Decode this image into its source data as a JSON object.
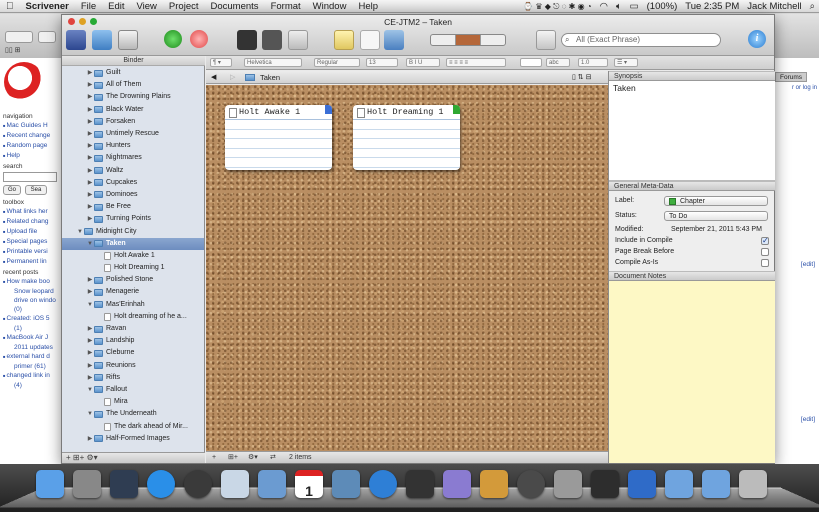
{
  "menubar": {
    "apple": "",
    "app": "Scrivener",
    "items": [
      "File",
      "Edit",
      "View",
      "Project",
      "Documents",
      "Format",
      "Window",
      "Help"
    ],
    "battery": "(100%)",
    "clock": "Tue 2:35 PM",
    "user": "Jack Mitchell"
  },
  "browser": {
    "forums_tab": "Forums",
    "login": "r or log in",
    "sections": {
      "navigation": "navigation",
      "nav_links": [
        "Mac Guides H",
        "Recent change",
        "Random page",
        "Help"
      ],
      "search": "search",
      "go": "Go",
      "sea": "Sea",
      "toolbox": "toolbox",
      "toolbox_links": [
        "What links her",
        "Related chang",
        "Upload file",
        "Special pages",
        "Printable versi",
        "Permanent lin"
      ],
      "recent_posts": "recent posts",
      "posts": [
        "How make boo",
        "Snow leopard",
        "drive on windo",
        "(0)",
        "Created: iOS 5",
        "(1)",
        "MacBook Air J",
        "2011 updates",
        "external hard d",
        "primer (61)",
        "changed link in",
        "(4)"
      ]
    },
    "edit1": "[edit]",
    "edit2": "[edit]"
  },
  "window": {
    "title": "CE-JTM2 – Taken",
    "search_placeholder": "All (Exact Phrase)"
  },
  "format_bar": {
    "font": "Helvetica",
    "style": "Regular",
    "size": "13",
    "abc": "abc",
    "spacing": "1.0"
  },
  "binder": {
    "header": "Binder",
    "items": [
      {
        "label": "Guilt",
        "depth": 1,
        "type": "folder",
        "expanded": false
      },
      {
        "label": "All of Them",
        "depth": 1,
        "type": "folder",
        "expanded": false
      },
      {
        "label": "The Drowning Plains",
        "depth": 1,
        "type": "folder",
        "expanded": false
      },
      {
        "label": "Black Water",
        "depth": 1,
        "type": "folder",
        "expanded": false
      },
      {
        "label": "Forsaken",
        "depth": 1,
        "type": "folder",
        "expanded": false
      },
      {
        "label": "Untimely Rescue",
        "depth": 1,
        "type": "folder",
        "expanded": false
      },
      {
        "label": "Hunters",
        "depth": 1,
        "type": "folder",
        "expanded": false
      },
      {
        "label": "Nightmares",
        "depth": 1,
        "type": "folder",
        "expanded": false
      },
      {
        "label": "Waltz",
        "depth": 1,
        "type": "folder",
        "expanded": false
      },
      {
        "label": "Cupcakes",
        "depth": 1,
        "type": "folder",
        "expanded": false
      },
      {
        "label": "Dominoes",
        "depth": 1,
        "type": "folder",
        "expanded": false
      },
      {
        "label": "Be Free",
        "depth": 1,
        "type": "folder",
        "expanded": false
      },
      {
        "label": "Turning Points",
        "depth": 1,
        "type": "folder",
        "expanded": false
      },
      {
        "label": "Midnight City",
        "depth": 0,
        "type": "folder",
        "expanded": true
      },
      {
        "label": "Taken",
        "depth": 1,
        "type": "folder",
        "expanded": true,
        "selected": true
      },
      {
        "label": "Holt Awake 1",
        "depth": 2,
        "type": "doc"
      },
      {
        "label": "Holt Dreaming 1",
        "depth": 2,
        "type": "doc"
      },
      {
        "label": "Polished Stone",
        "depth": 1,
        "type": "folder",
        "expanded": false
      },
      {
        "label": "Menagerie",
        "depth": 1,
        "type": "folder",
        "expanded": false
      },
      {
        "label": "Mas'Erinhah",
        "depth": 1,
        "type": "folder",
        "expanded": true
      },
      {
        "label": "Holt dreaming of he a...",
        "depth": 2,
        "type": "doc"
      },
      {
        "label": "Ravan",
        "depth": 1,
        "type": "folder",
        "expanded": false
      },
      {
        "label": "Landship",
        "depth": 1,
        "type": "folder",
        "expanded": false
      },
      {
        "label": "Cleburne",
        "depth": 1,
        "type": "folder",
        "expanded": false
      },
      {
        "label": "Reunions",
        "depth": 1,
        "type": "folder",
        "expanded": false
      },
      {
        "label": "Rifts",
        "depth": 1,
        "type": "folder",
        "expanded": false
      },
      {
        "label": "Fallout",
        "depth": 1,
        "type": "folder",
        "expanded": true
      },
      {
        "label": "Mira",
        "depth": 2,
        "type": "doc"
      },
      {
        "label": "The Underneath",
        "depth": 1,
        "type": "folder",
        "expanded": true
      },
      {
        "label": "The dark ahead of Mir...",
        "depth": 2,
        "type": "doc"
      },
      {
        "label": "Half-Formed Images",
        "depth": 1,
        "type": "folder",
        "expanded": false
      }
    ],
    "footer": "+ ⊞+ ⚙▾"
  },
  "editor": {
    "header_title": "Taken",
    "cards": [
      {
        "title": "Holt Awake 1",
        "flag_color": "#3b6fd6"
      },
      {
        "title": "Holt Dreaming 1",
        "flag_color": "#2fa832"
      }
    ],
    "footer_count": "2 items"
  },
  "inspector": {
    "synopsis_header": "Synopsis",
    "synopsis_text": "Taken",
    "meta_header": "General Meta-Data",
    "label_key": "Label:",
    "label_value": "Chapter",
    "label_color": "#3fae3f",
    "status_key": "Status:",
    "status_value": "To Do",
    "modified_key": "Modified:",
    "modified_value": "September 21, 2011 5:43 PM",
    "include_compile": "Include in Compile",
    "page_break": "Page Break Before",
    "compile_as_is": "Compile As-Is",
    "notes_header": "Document Notes",
    "include_checked": true
  },
  "dock": {
    "icons": [
      "finder-icon",
      "launchpad-icon",
      "dashboard-icon",
      "app-store-icon",
      "safari-icon",
      "preview-icon",
      "mail-icon",
      "calendar-icon",
      "iphoto-icon",
      "itunes-icon",
      "photo-booth-icon",
      "imovie-icon",
      "garageband-icon",
      "time-machine-icon",
      "system-preferences-icon",
      "scrivener-icon",
      "word-icon",
      "folder-icon",
      "downloads-icon",
      "trash-icon"
    ],
    "calendar_day": "1"
  }
}
